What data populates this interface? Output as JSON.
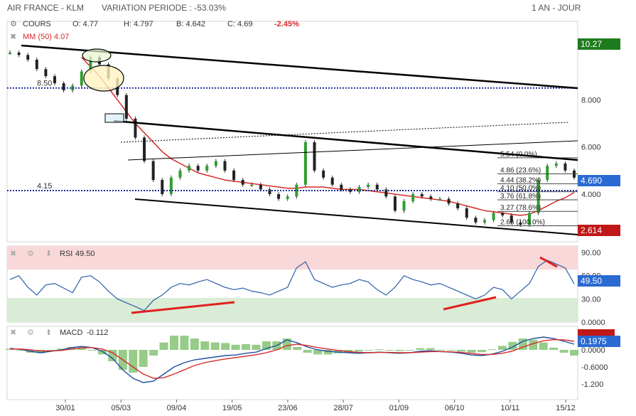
{
  "header": {
    "name": "AIR FRANCE - KLM",
    "variation": "VARIATION PERIODE : -53.03%",
    "period": "1 AN - JOUR"
  },
  "legend": {
    "cours": "COURS",
    "o": "O: 4.77",
    "h": "H: 4.797",
    "b": "B: 4.642",
    "c": "C: 4.69",
    "chg": "-2.45%",
    "mm": "MM (50) 4.07"
  },
  "rsi_panel": {
    "label": "RSI",
    "value": "49.50"
  },
  "macd_panel": {
    "label": "MACD",
    "value": "-0.112"
  },
  "colors": {
    "price": "#2e9e2e",
    "ma": "#d42a2a",
    "rsi": "#2b5fa8",
    "macd": "#1f4fa0",
    "signal": "#d42a2a",
    "hist": "#7cbf6a",
    "badge_green": "#1e7b1e",
    "badge_blue": "#2a6ad2",
    "badge_red": "#c01818"
  },
  "chart_data": [
    {
      "type": "line",
      "title": "AIR FRANCE - KLM",
      "x_tick_labels": [
        "30/01",
        "05/03",
        "09/04",
        "19/05",
        "23/06",
        "28/07",
        "01/09",
        "06/10",
        "10/11",
        "15/12"
      ],
      "y_ticks": [
        "8.000",
        "6.000",
        "4.000"
      ],
      "series": [
        {
          "name": "COURS",
          "values": [
            10.0,
            9.9,
            9.7,
            9.3,
            9.0,
            8.7,
            8.4,
            8.6,
            9.2,
            9.8,
            9.5,
            8.9,
            8.2,
            7.2,
            6.4,
            5.4,
            4.6,
            4.0,
            4.7,
            5.0,
            5.2,
            5.0,
            5.2,
            5.4,
            5.0,
            4.6,
            4.4,
            4.4,
            4.2,
            4.0,
            3.8,
            3.9,
            4.4,
            6.2,
            5.0,
            4.7,
            4.4,
            4.2,
            4.1,
            4.3,
            4.4,
            4.2,
            3.9,
            3.3,
            3.7,
            4.0,
            3.9,
            3.8,
            3.8,
            3.6,
            3.4,
            3.0,
            2.8,
            2.9,
            3.2,
            3.1,
            2.8,
            2.7,
            3.2,
            4.6,
            5.2,
            5.3,
            5.0,
            4.7
          ]
        },
        {
          "name": "MM (50)",
          "values": [
            null,
            null,
            null,
            null,
            null,
            null,
            null,
            null,
            9.8,
            9.4,
            9.0,
            8.5,
            8.0,
            7.5,
            7.0,
            6.6,
            6.2,
            5.8,
            5.5,
            5.3,
            5.1,
            4.9,
            4.8,
            4.7,
            4.6,
            4.55,
            4.5,
            4.45,
            4.4,
            4.35,
            4.3,
            4.25,
            4.25,
            4.3,
            4.3,
            4.3,
            4.25,
            4.2,
            4.2,
            4.2,
            4.15,
            4.1,
            4.05,
            4.0,
            3.95,
            3.9,
            3.85,
            3.8,
            3.75,
            3.7,
            3.6,
            3.5,
            3.4,
            3.3,
            3.25,
            3.2,
            3.15,
            3.1,
            3.15,
            3.3,
            3.5,
            3.7,
            3.85,
            4.07
          ]
        }
      ],
      "price_badges": [
        "10.27",
        "4.690",
        "2.614"
      ],
      "levels": [
        {
          "label": "8.50",
          "value": 8.5
        },
        {
          "label": "4.15",
          "value": 4.15
        }
      ],
      "fibonacci": [
        {
          "label": "5.54 (0.0%)",
          "value": 5.54
        },
        {
          "label": "4.86 (23.6%)",
          "value": 4.86
        },
        {
          "label": "4.44 (38.2%)",
          "value": 4.44
        },
        {
          "label": "4.10 (50.0%)",
          "value": 4.1
        },
        {
          "label": "3.76 (61.8%)",
          "value": 3.76
        },
        {
          "label": "3.27 (78.6%)",
          "value": 3.27
        },
        {
          "label": "2.66 (100.0%)",
          "value": 2.66
        }
      ],
      "grid": false
    },
    {
      "type": "line",
      "title": "RSI",
      "y_ticks": [
        "90.00",
        "60.00",
        "30.00",
        "0.0000"
      ],
      "zones": {
        "overbought": 70,
        "oversold": 30
      },
      "series": [
        {
          "name": "RSI",
          "values": [
            55,
            60,
            45,
            35,
            48,
            50,
            44,
            38,
            58,
            60,
            52,
            40,
            30,
            25,
            20,
            15,
            28,
            35,
            45,
            50,
            48,
            52,
            55,
            50,
            45,
            42,
            44,
            40,
            38,
            35,
            40,
            45,
            70,
            78,
            55,
            50,
            45,
            48,
            50,
            55,
            52,
            42,
            35,
            45,
            60,
            55,
            52,
            48,
            50,
            45,
            40,
            35,
            30,
            35,
            45,
            42,
            30,
            40,
            50,
            72,
            80,
            75,
            70,
            49.5
          ]
        }
      ],
      "badge": "49.50"
    },
    {
      "type": "line",
      "title": "MACD",
      "y_ticks": [
        "0.6000",
        "0.2000",
        "0.0000",
        "-0.6000",
        "-1.200"
      ],
      "series": [
        {
          "name": "MACD",
          "values": [
            0.05,
            0.02,
            -0.05,
            -0.1,
            -0.05,
            0.0,
            0.08,
            0.12,
            0.08,
            -0.05,
            -0.3,
            -0.7,
            -1.0,
            -1.15,
            -1.1,
            -0.85,
            -0.6,
            -0.45,
            -0.35,
            -0.3,
            -0.25,
            -0.2,
            -0.18,
            -0.12,
            -0.08,
            0.05,
            0.15,
            0.35,
            0.25,
            0.1,
            0.0,
            -0.05,
            -0.08,
            -0.1,
            -0.12,
            -0.1,
            -0.08,
            -0.1,
            -0.12,
            -0.1,
            -0.05,
            -0.03,
            -0.06,
            -0.08,
            -0.12,
            -0.18,
            -0.2,
            -0.15,
            -0.05,
            0.1,
            0.3,
            0.4,
            0.45,
            0.4,
            0.3,
            0.2
          ]
        },
        {
          "name": "Signal",
          "values": [
            0.03,
            0.03,
            0.0,
            -0.04,
            -0.04,
            -0.02,
            0.03,
            0.07,
            0.08,
            0.03,
            -0.1,
            -0.35,
            -0.6,
            -0.85,
            -1.0,
            -0.98,
            -0.85,
            -0.7,
            -0.55,
            -0.45,
            -0.38,
            -0.32,
            -0.27,
            -0.22,
            -0.17,
            -0.1,
            0.0,
            0.15,
            0.2,
            0.15,
            0.08,
            0.03,
            -0.02,
            -0.06,
            -0.09,
            -0.1,
            -0.09,
            -0.09,
            -0.1,
            -0.1,
            -0.08,
            -0.06,
            -0.06,
            -0.07,
            -0.09,
            -0.13,
            -0.16,
            -0.16,
            -0.12,
            -0.04,
            0.1,
            0.22,
            0.32,
            0.36,
            0.35,
            0.3
          ]
        }
      ],
      "badges": [
        "0.1975"
      ]
    }
  ]
}
